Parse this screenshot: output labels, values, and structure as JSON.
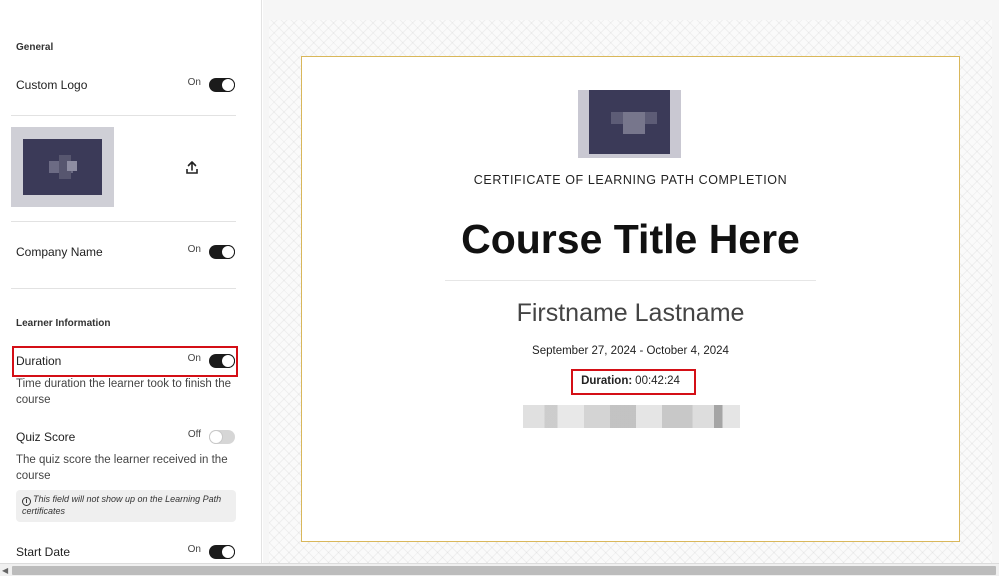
{
  "sidebar": {
    "general_heading": "General",
    "custom_logo": {
      "label": "Custom Logo",
      "state": "On"
    },
    "company_name": {
      "label": "Company Name",
      "state": "On"
    },
    "learner_heading": "Learner Information",
    "duration": {
      "label": "Duration",
      "state": "On",
      "description": "Time duration the learner took to finish the course"
    },
    "quiz_score": {
      "label": "Quiz Score",
      "state": "Off",
      "description": "The quiz score the learner received in the course",
      "note": "This field will not show up on the Learning Path certificates"
    },
    "start_date": {
      "label": "Start Date",
      "state": "On"
    }
  },
  "certificate": {
    "kicker": "CERTIFICATE OF LEARNING PATH COMPLETION",
    "title": "Course Title Here",
    "learner_name": "Firstname Lastname",
    "dates": "September 27, 2024 - October 4, 2024",
    "duration_label": "Duration:",
    "duration_value": "00:42:24"
  },
  "colors": {
    "highlight": "#d40f16",
    "toggle_on": "#1b1b1b",
    "toggle_off": "#d6d6d6",
    "certificate_border": "#d9b75a"
  }
}
